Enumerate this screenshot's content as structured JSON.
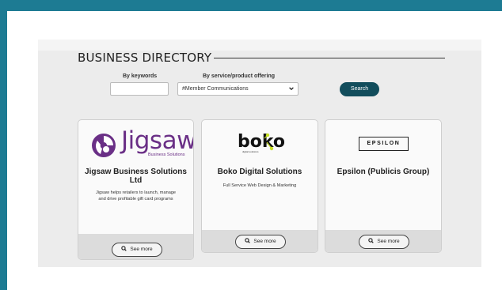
{
  "directory": {
    "title": "BUSINESS DIRECTORY",
    "keywords_label": "By keywords",
    "keywords_value": "",
    "service_label": "By service/product offering",
    "service_selected": "#Member Communications",
    "search_label": "Search"
  },
  "colors": {
    "frame": "#1d7b93",
    "search_button": "#124d5c",
    "jigsaw_brand": "#6a2f86",
    "boko_accent": "#c7e023"
  },
  "cards": [
    {
      "logo_text": "Jigsaw",
      "logo_subtext": "Business Solutions",
      "title_line1": "Jigsaw Business Solutions",
      "title_line2": "Ltd",
      "desc_line1": "Jigsaw helps retailers to launch, manage",
      "desc_line2": "and drive profitable gift card programs",
      "button": "See more"
    },
    {
      "logo_text": "boko",
      "logo_subtext": "digital solutions",
      "title": "Boko Digital Solutions",
      "desc": "Full Service Web Design & Marketing",
      "button": "See more"
    },
    {
      "logo_text": "EPSILON",
      "title": "Epsilon (Publicis Group)",
      "button": "See more"
    }
  ]
}
